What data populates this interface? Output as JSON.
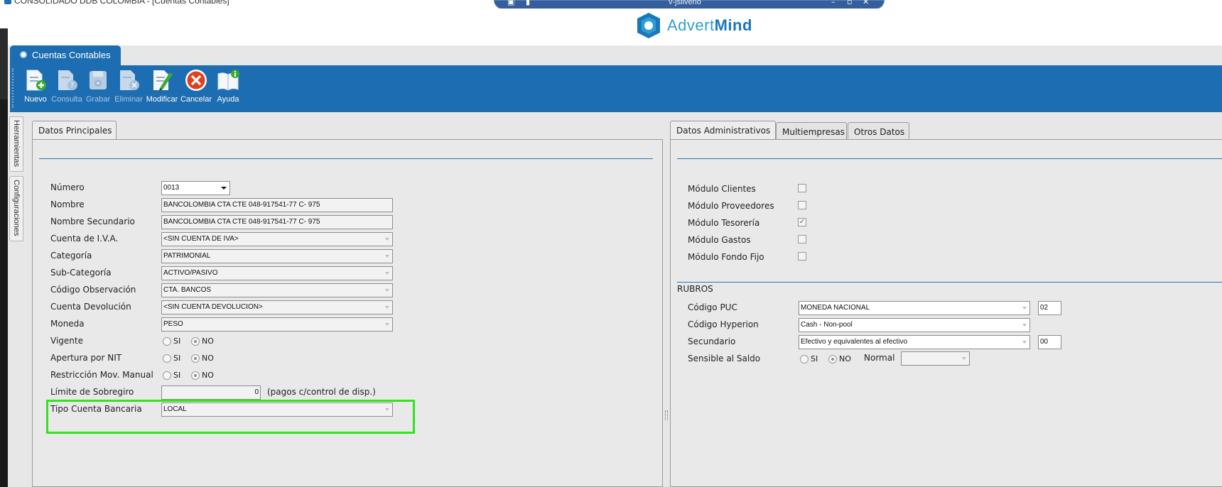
{
  "window": {
    "title": "CONSOLIDADO DDB COLOMBIA - [Cuentas Contables]",
    "remote_session": "v-jsilverio"
  },
  "brand": {
    "prefix": "Advert",
    "suffix": "Mind"
  },
  "vertical_tabs": [
    "Herramientas",
    "Configuraciones"
  ],
  "main_tab": {
    "label": "Cuentas Contables"
  },
  "toolbar": {
    "nuevo": "Nuevo",
    "consulta": "Consulta",
    "grabar": "Grabar",
    "eliminar": "Eliminar",
    "modificar": "Modificar",
    "cancelar": "Cancelar",
    "ayuda": "Ayuda"
  },
  "left_panel": {
    "tab": "Datos Principales",
    "fields": {
      "numero": {
        "label": "Número",
        "value": "0013"
      },
      "nombre": {
        "label": "Nombre",
        "value": "BANCOLOMBIA CTA CTE 048-917541-77 C- 975"
      },
      "nombre_secundario": {
        "label": "Nombre Secundario",
        "value": "BANCOLOMBIA CTA CTE 048-917541-77 C- 975"
      },
      "cuenta_iva": {
        "label": "Cuenta de I.V.A.",
        "value": "<SIN CUENTA DE IVA>"
      },
      "categoria": {
        "label": "Categoría",
        "value": "PATRIMONIAL"
      },
      "subcategoria": {
        "label": "Sub-Categoría",
        "value": "ACTIVO/PASIVO"
      },
      "codigo_observacion": {
        "label": "Código Observación",
        "value": "CTA. BANCOS"
      },
      "cuenta_devolucion": {
        "label": "Cuenta Devolución",
        "value": "<SIN CUENTA DEVOLUCION>"
      },
      "moneda": {
        "label": "Moneda",
        "value": "PESO"
      },
      "vigente": {
        "label": "Vigente"
      },
      "apertura_nit": {
        "label": "Apertura por NIT"
      },
      "restriccion": {
        "label": "Restricción Mov. Manual"
      },
      "limite": {
        "label": "Límite de Sobregiro",
        "value": "0",
        "note": "(pagos c/control de disp.)"
      },
      "tipo_cuenta": {
        "label": "Tipo Cuenta Bancaria",
        "value": "LOCAL"
      }
    },
    "radio_si": "SI",
    "radio_no": "NO"
  },
  "right_panel": {
    "tabs": [
      "Datos Administrativos",
      "Multiempresas",
      "Otros Datos"
    ],
    "modules": {
      "clientes": {
        "label": "Módulo Clientes",
        "checked": false
      },
      "proveedores": {
        "label": "Módulo Proveedores",
        "checked": false
      },
      "tesoreria": {
        "label": "Módulo Tesorería",
        "checked": true
      },
      "gastos": {
        "label": "Módulo Gastos",
        "checked": false
      },
      "fondo_fijo": {
        "label": "Módulo Fondo Fijo",
        "checked": false
      }
    },
    "rubros": {
      "title": "RUBROS",
      "codigo_puc": {
        "label": "Código PUC",
        "value": "MONEDA NACIONAL",
        "code": "02"
      },
      "codigo_hyperion": {
        "label": "Código Hyperion",
        "value": "Cash - Non-pool"
      },
      "secundario": {
        "label": "Secundario",
        "value": "Efectivo y equivalentes al efectivo",
        "code": "00"
      },
      "sensible": {
        "label": "Sensible al Saldo",
        "normal_label": "Normal",
        "normal_value": ""
      }
    }
  },
  "colors": {
    "accent": "#1c6db1",
    "highlight": "#2ee61e"
  }
}
